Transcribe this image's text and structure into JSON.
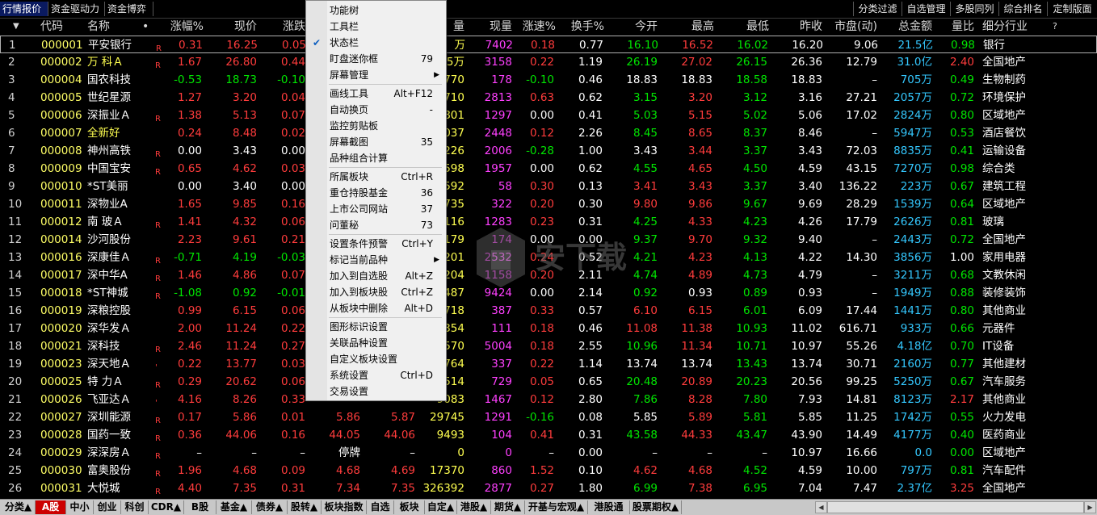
{
  "top_tabs_left": [
    "行情报价",
    "资金驱动力",
    "资金博弈"
  ],
  "top_tabs_right": [
    "分类过滤",
    "自选管理",
    "多股同列",
    "综合排名",
    "定制版面"
  ],
  "headers": [
    "代码",
    "名称",
    "•",
    "涨幅%",
    "现价",
    "涨跌",
    "量",
    "现量",
    "涨速%",
    "换手%",
    "今开",
    "最高",
    "最低",
    "昨收",
    "市盘(动)",
    "总金额",
    "量比",
    "细分行业",
    "?"
  ],
  "rows": [
    {
      "n": "1",
      "code": "000001",
      "name": "平安银行",
      "flag": "R",
      "chg": "0.31",
      "price": "16.25",
      "diff": "0.05",
      "vol": "万",
      "cur": "7402",
      "spd": "0.18",
      "turn": "0.77",
      "open": "16.10",
      "high": "16.52",
      "low": "16.02",
      "prev": "16.20",
      "pe": "9.06",
      "amt": "21.5亿",
      "vr": "0.98",
      "ind": "银行"
    },
    {
      "n": "2",
      "code": "000002",
      "name": "万 科Ａ",
      "flag": "R",
      "chg": "1.67",
      "price": "26.80",
      "diff": "0.44",
      "vol": "5万",
      "cur": "3158",
      "spd": "0.22",
      "turn": "1.19",
      "open": "26.19",
      "high": "27.02",
      "low": "26.15",
      "prev": "26.36",
      "pe": "12.79",
      "amt": "31.0亿",
      "vr": "2.40",
      "ind": "全国地产"
    },
    {
      "n": "3",
      "code": "000004",
      "name": "国农科技",
      "flag": "",
      "chg": "-0.53",
      "price": "18.73",
      "diff": "-0.10",
      "vol": "770",
      "cur": "178",
      "spd": "-0.10",
      "turn": "0.46",
      "open": "18.83",
      "high": "18.83",
      "low": "18.58",
      "prev": "18.83",
      "pe": "–",
      "amt": "705万",
      "vr": "0.49",
      "ind": "生物制药"
    },
    {
      "n": "4",
      "code": "000005",
      "name": "世纪星源",
      "flag": "",
      "chg": "1.27",
      "price": "3.20",
      "diff": "0.04",
      "vol": "710",
      "cur": "2813",
      "spd": "0.63",
      "turn": "0.62",
      "open": "3.15",
      "high": "3.20",
      "low": "3.12",
      "prev": "3.16",
      "pe": "27.21",
      "amt": "2057万",
      "vr": "0.72",
      "ind": "环境保护"
    },
    {
      "n": "5",
      "code": "000006",
      "name": "深振业Ａ",
      "flag": "R",
      "chg": "1.38",
      "price": "5.13",
      "diff": "0.07",
      "vol": "801",
      "cur": "1297",
      "spd": "0.00",
      "turn": "0.41",
      "open": "5.03",
      "high": "5.15",
      "low": "5.02",
      "prev": "5.06",
      "pe": "17.02",
      "amt": "2824万",
      "vr": "0.80",
      "ind": "区域地产"
    },
    {
      "n": "6",
      "code": "000007",
      "name": "全新好",
      "flag": "",
      "chg": "0.24",
      "price": "8.48",
      "diff": "0.02",
      "vol": "037",
      "cur": "2448",
      "spd": "0.12",
      "turn": "2.26",
      "open": "8.45",
      "high": "8.65",
      "low": "8.37",
      "prev": "8.46",
      "pe": "–",
      "amt": "5947万",
      "vr": "0.53",
      "ind": "酒店餐饮"
    },
    {
      "n": "7",
      "code": "000008",
      "name": "神州高铁",
      "flag": "R",
      "chg": "0.00",
      "price": "3.43",
      "diff": "0.00",
      "vol": "226",
      "cur": "2006",
      "spd": "-0.28",
      "turn": "1.00",
      "open": "3.43",
      "high": "3.44",
      "low": "3.37",
      "prev": "3.43",
      "pe": "72.03",
      "amt": "8835万",
      "vr": "0.41",
      "ind": "运输设备"
    },
    {
      "n": "8",
      "code": "000009",
      "name": "中国宝安",
      "flag": "R",
      "chg": "0.65",
      "price": "4.62",
      "diff": "0.03",
      "vol": "598",
      "cur": "1957",
      "spd": "0.00",
      "turn": "0.62",
      "open": "4.55",
      "high": "4.65",
      "low": "4.50",
      "prev": "4.59",
      "pe": "43.15",
      "amt": "7270万",
      "vr": "0.98",
      "ind": "综合类"
    },
    {
      "n": "9",
      "code": "000010",
      "name": "*ST美丽",
      "flag": "",
      "chg": "0.00",
      "price": "3.40",
      "diff": "0.00",
      "vol": "592",
      "cur": "58",
      "spd": "0.30",
      "turn": "0.13",
      "open": "3.41",
      "high": "3.43",
      "low": "3.37",
      "prev": "3.40",
      "pe": "136.22",
      "amt": "223万",
      "vr": "0.67",
      "ind": "建筑工程"
    },
    {
      "n": "10",
      "code": "000011",
      "name": "深物业A",
      "flag": "",
      "chg": "1.65",
      "price": "9.85",
      "diff": "0.16",
      "vol": "735",
      "cur": "322",
      "spd": "0.20",
      "turn": "0.30",
      "open": "9.80",
      "high": "9.86",
      "low": "9.67",
      "prev": "9.69",
      "pe": "28.29",
      "amt": "1539万",
      "vr": "0.64",
      "ind": "区域地产"
    },
    {
      "n": "11",
      "code": "000012",
      "name": "南 玻Ａ",
      "flag": "R",
      "chg": "1.41",
      "price": "4.32",
      "diff": "0.06",
      "vol": "116",
      "cur": "1283",
      "spd": "0.23",
      "turn": "0.31",
      "open": "4.25",
      "high": "4.33",
      "low": "4.23",
      "prev": "4.26",
      "pe": "17.79",
      "amt": "2626万",
      "vr": "0.81",
      "ind": "玻璃"
    },
    {
      "n": "12",
      "code": "000014",
      "name": "沙河股份",
      "flag": "",
      "chg": "2.23",
      "price": "9.61",
      "diff": "0.21",
      "vol": "179",
      "cur": "174",
      "spd": "0.00",
      "turn": "0.00",
      "open": "9.37",
      "high": "9.70",
      "low": "9.32",
      "prev": "9.40",
      "pe": "–",
      "amt": "2443万",
      "vr": "0.72",
      "ind": "全国地产"
    },
    {
      "n": "13",
      "code": "000016",
      "name": "深康佳Ａ",
      "flag": "R",
      "chg": "-0.71",
      "price": "4.19",
      "diff": "-0.03",
      "vol": "201",
      "cur": "2532",
      "spd": "0.24",
      "turn": "0.52",
      "open": "4.21",
      "high": "4.23",
      "low": "4.13",
      "prev": "4.22",
      "pe": "14.30",
      "amt": "3856万",
      "vr": "1.00",
      "ind": "家用电器"
    },
    {
      "n": "14",
      "code": "000017",
      "name": "深中华A",
      "flag": "R",
      "chg": "1.46",
      "price": "4.86",
      "diff": "0.07",
      "vol": "204",
      "cur": "1158",
      "spd": "0.20",
      "turn": "2.11",
      "open": "4.74",
      "high": "4.89",
      "low": "4.73",
      "prev": "4.79",
      "pe": "–",
      "amt": "3211万",
      "vr": "0.68",
      "ind": "文教休闲"
    },
    {
      "n": "15",
      "code": "000018",
      "name": "*ST神城",
      "flag": "R",
      "chg": "-1.08",
      "price": "0.92",
      "diff": "-0.01",
      "vol": "487",
      "cur": "9424",
      "spd": "0.00",
      "turn": "2.14",
      "open": "0.92",
      "high": "0.93",
      "low": "0.89",
      "prev": "0.93",
      "pe": "–",
      "amt": "1949万",
      "vr": "0.88",
      "ind": "装修装饰"
    },
    {
      "n": "16",
      "code": "000019",
      "name": "深粮控股",
      "flag": "",
      "chg": "0.99",
      "price": "6.15",
      "diff": "0.06",
      "vol": "718",
      "cur": "387",
      "spd": "0.33",
      "turn": "0.57",
      "open": "6.10",
      "high": "6.15",
      "low": "6.01",
      "prev": "6.09",
      "pe": "17.44",
      "amt": "1441万",
      "vr": "0.80",
      "ind": "其他商业"
    },
    {
      "n": "17",
      "code": "000020",
      "name": "深华发Ａ",
      "flag": "",
      "chg": "2.00",
      "price": "11.24",
      "diff": "0.22",
      "vol": "354",
      "cur": "111",
      "spd": "0.18",
      "turn": "0.46",
      "open": "11.08",
      "high": "11.38",
      "low": "10.93",
      "prev": "11.02",
      "pe": "616.71",
      "amt": "933万",
      "vr": "0.66",
      "ind": "元器件"
    },
    {
      "n": "18",
      "code": "000021",
      "name": "深科技",
      "flag": "R",
      "chg": "2.46",
      "price": "11.24",
      "diff": "0.27",
      "vol": "570",
      "cur": "5004",
      "spd": "0.18",
      "turn": "2.55",
      "open": "10.96",
      "high": "11.34",
      "low": "10.71",
      "prev": "10.97",
      "pe": "55.26",
      "amt": "4.18亿",
      "vr": "0.70",
      "ind": "IT设备"
    },
    {
      "n": "19",
      "code": "000023",
      "name": "深天地Ａ",
      "flag": "'",
      "chg": "0.22",
      "price": "13.77",
      "diff": "0.03",
      "vol": "764",
      "cur": "337",
      "spd": "0.22",
      "turn": "1.14",
      "open": "13.74",
      "high": "13.74",
      "low": "13.43",
      "prev": "13.74",
      "pe": "30.71",
      "amt": "2160万",
      "vr": "0.77",
      "ind": "其他建材"
    },
    {
      "n": "20",
      "code": "000025",
      "name": "特 力Ａ",
      "flag": "R",
      "chg": "0.29",
      "price": "20.62",
      "diff": "0.06",
      "vol": "514",
      "cur": "729",
      "spd": "0.05",
      "turn": "0.65",
      "open": "20.48",
      "high": "20.89",
      "low": "20.23",
      "prev": "20.56",
      "pe": "99.25",
      "amt": "5250万",
      "vr": "0.67",
      "ind": "汽车服务"
    },
    {
      "n": "21",
      "code": "000026",
      "name": "飞亚达Ａ",
      "flag": "'",
      "chg": "4.16",
      "price": "8.26",
      "diff": "0.33",
      "vol": "9083",
      "cur": "1467",
      "spd": "0.12",
      "turn": "2.80",
      "open": "7.86",
      "high": "8.28",
      "low": "7.80",
      "prev": "7.93",
      "pe": "14.81",
      "amt": "8123万",
      "vr": "2.17",
      "ind": "其他商业"
    },
    {
      "n": "22",
      "code": "000027",
      "name": "深圳能源",
      "flag": "R",
      "chg": "0.17",
      "price": "5.86",
      "diff": "0.01",
      "col7": "5.86",
      "col8": "5.87",
      "vol": "29745",
      "cur": "1291",
      "spd": "-0.16",
      "turn": "0.08",
      "open": "5.85",
      "high": "5.89",
      "low": "5.81",
      "prev": "5.85",
      "pe": "11.25",
      "amt": "1742万",
      "vr": "0.55",
      "ind": "火力发电"
    },
    {
      "n": "23",
      "code": "000028",
      "name": "国药一致",
      "flag": "R",
      "chg": "0.36",
      "price": "44.06",
      "diff": "0.16",
      "col7": "44.05",
      "col8": "44.06",
      "vol": "9493",
      "cur": "104",
      "spd": "0.41",
      "turn": "0.31",
      "open": "43.58",
      "high": "44.33",
      "low": "43.47",
      "prev": "43.90",
      "pe": "14.49",
      "amt": "4177万",
      "vr": "0.40",
      "ind": "医药商业"
    },
    {
      "n": "24",
      "code": "000029",
      "name": "深深房Ａ",
      "flag": "R",
      "chg": "–",
      "price": "–",
      "diff": "–",
      "col7": "停牌",
      "col8": "–",
      "vol": "0",
      "cur": "0",
      "spd": "–",
      "turn": "0.00",
      "open": "–",
      "high": "–",
      "low": "–",
      "prev": "10.97",
      "pe": "16.66",
      "amt": "0.0",
      "vr": "0.00",
      "ind": "区域地产"
    },
    {
      "n": "25",
      "code": "000030",
      "name": "富奥股份",
      "flag": "R",
      "chg": "1.96",
      "price": "4.68",
      "diff": "0.09",
      "col7": "4.68",
      "col8": "4.69",
      "vol": "17370",
      "cur": "860",
      "spd": "1.52",
      "turn": "0.10",
      "open": "4.62",
      "high": "4.68",
      "low": "4.52",
      "prev": "4.59",
      "pe": "10.00",
      "amt": "797万",
      "vr": "0.81",
      "ind": "汽车配件"
    },
    {
      "n": "26",
      "code": "000031",
      "name": "大悦城",
      "flag": "R",
      "chg": "4.40",
      "price": "7.35",
      "diff": "0.31",
      "col7": "7.34",
      "col8": "7.35",
      "vol": "326392",
      "cur": "2877",
      "spd": "0.27",
      "turn": "1.80",
      "open": "6.99",
      "high": "7.38",
      "low": "6.95",
      "prev": "7.04",
      "pe": "7.47",
      "amt": "2.37亿",
      "vr": "3.25",
      "ind": "全国地产"
    }
  ],
  "context_menu": [
    {
      "label": "功能树",
      "shortcut": "",
      "check": false,
      "arrow": false,
      "sep_before": false
    },
    {
      "label": "工具栏",
      "shortcut": "",
      "check": false,
      "arrow": false,
      "sep_before": false
    },
    {
      "label": "状态栏",
      "shortcut": "",
      "check": true,
      "arrow": false,
      "sep_before": false
    },
    {
      "label": "盯盘迷你框",
      "shortcut": "79",
      "check": false,
      "arrow": false,
      "sep_before": false
    },
    {
      "label": "屏幕管理",
      "shortcut": "",
      "check": false,
      "arrow": true,
      "sep_before": false
    },
    {
      "label": "画线工具",
      "shortcut": "Alt+F12",
      "check": false,
      "arrow": false,
      "sep_before": true
    },
    {
      "label": "自动换页",
      "shortcut": "-",
      "check": false,
      "arrow": false,
      "sep_before": false
    },
    {
      "label": "监控剪贴板",
      "shortcut": "",
      "check": false,
      "arrow": false,
      "sep_before": false
    },
    {
      "label": "屏幕截图",
      "shortcut": "35",
      "check": false,
      "arrow": false,
      "sep_before": false
    },
    {
      "label": "品种组合计算",
      "shortcut": "",
      "check": false,
      "arrow": false,
      "sep_before": false
    },
    {
      "label": "所属板块",
      "shortcut": "Ctrl+R",
      "check": false,
      "arrow": false,
      "sep_before": true
    },
    {
      "label": "重仓持股基金",
      "shortcut": "36",
      "check": false,
      "arrow": false,
      "sep_before": false
    },
    {
      "label": "上市公司网站",
      "shortcut": "37",
      "check": false,
      "arrow": false,
      "sep_before": false
    },
    {
      "label": "问董秘",
      "shortcut": "73",
      "check": false,
      "arrow": false,
      "sep_before": false
    },
    {
      "label": "设置条件预警",
      "shortcut": "Ctrl+Y",
      "check": false,
      "arrow": false,
      "sep_before": true
    },
    {
      "label": "标记当前品种",
      "shortcut": "",
      "check": false,
      "arrow": true,
      "sep_before": false
    },
    {
      "label": "加入到自选股",
      "shortcut": "Alt+Z",
      "check": false,
      "arrow": false,
      "sep_before": false
    },
    {
      "label": "加入到板块股",
      "shortcut": "Ctrl+Z",
      "check": false,
      "arrow": false,
      "sep_before": false
    },
    {
      "label": "从板块中删除",
      "shortcut": "Alt+D",
      "check": false,
      "arrow": false,
      "sep_before": false
    },
    {
      "label": "图形标识设置",
      "shortcut": "",
      "check": false,
      "arrow": false,
      "sep_before": true
    },
    {
      "label": "关联品种设置",
      "shortcut": "",
      "check": false,
      "arrow": false,
      "sep_before": false
    },
    {
      "label": "自定义板块设置",
      "shortcut": "",
      "check": false,
      "arrow": false,
      "sep_before": false
    },
    {
      "label": "系统设置",
      "shortcut": "Ctrl+D",
      "check": false,
      "arrow": false,
      "sep_before": false
    },
    {
      "label": "交易设置",
      "shortcut": "",
      "check": false,
      "arrow": false,
      "sep_before": false
    }
  ],
  "bottom_tabs": [
    {
      "label": "分类▲",
      "active": false
    },
    {
      "label": "A股",
      "active": true
    },
    {
      "label": "中小",
      "active": false
    },
    {
      "label": "创业",
      "active": false
    },
    {
      "label": "科创",
      "active": false
    },
    {
      "label": "CDR▲",
      "active": false
    },
    {
      "label": "B股",
      "active": false
    },
    {
      "label": "基金▲",
      "active": false
    },
    {
      "label": "债券▲",
      "active": false
    },
    {
      "label": "股转▲",
      "active": false
    },
    {
      "label": "板块指数",
      "active": false
    },
    {
      "label": "自选",
      "active": false
    },
    {
      "label": "板块",
      "active": false
    },
    {
      "label": "自定▲",
      "active": false
    },
    {
      "label": "港股▲",
      "active": false
    },
    {
      "label": "期货▲",
      "active": false
    },
    {
      "label": "开基与宏观▲",
      "active": false
    },
    {
      "label": "港股通",
      "active": false
    },
    {
      "label": "股票期权▲",
      "active": false
    }
  ],
  "colors": {
    "up": "#ff3c3c",
    "down": "#00e600",
    "code": "#ffff66",
    "amount": "#34c8ff",
    "volume": "#ff40ff"
  },
  "watermark_label": "安下载"
}
